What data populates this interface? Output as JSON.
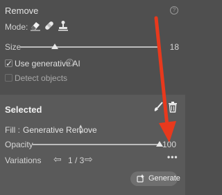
{
  "remove_panel": {
    "title": "Remove",
    "help_glyph": "?",
    "mode_label": "Mode:",
    "mode_icons": [
      "eraser-icon",
      "bandage-icon",
      "stamp-icon"
    ],
    "size_label": "Size",
    "size_value": "18",
    "size_level": 0.25,
    "use_generative_label": "Use generative AI",
    "use_generative_checked": true,
    "info_glyph": "?",
    "detect_objects_label": "Detect objects",
    "detect_objects_checked": false
  },
  "selected": {
    "title": "Selected",
    "fill_label": "Fill :",
    "fill_value": "Generative Remove",
    "opacity_label": "Opacity",
    "opacity_value": "100",
    "opacity_level": 1.0,
    "variations_label": "Variations",
    "variations_prev": "⇦",
    "variations_count": "1 / 3",
    "variations_next": "⇨",
    "more_glyph": "•••",
    "generate_label": "Generate"
  },
  "colors": {
    "background": "#4f4f4f",
    "selected_bg": "#5a5a5a",
    "arrow": "#e8391d"
  }
}
